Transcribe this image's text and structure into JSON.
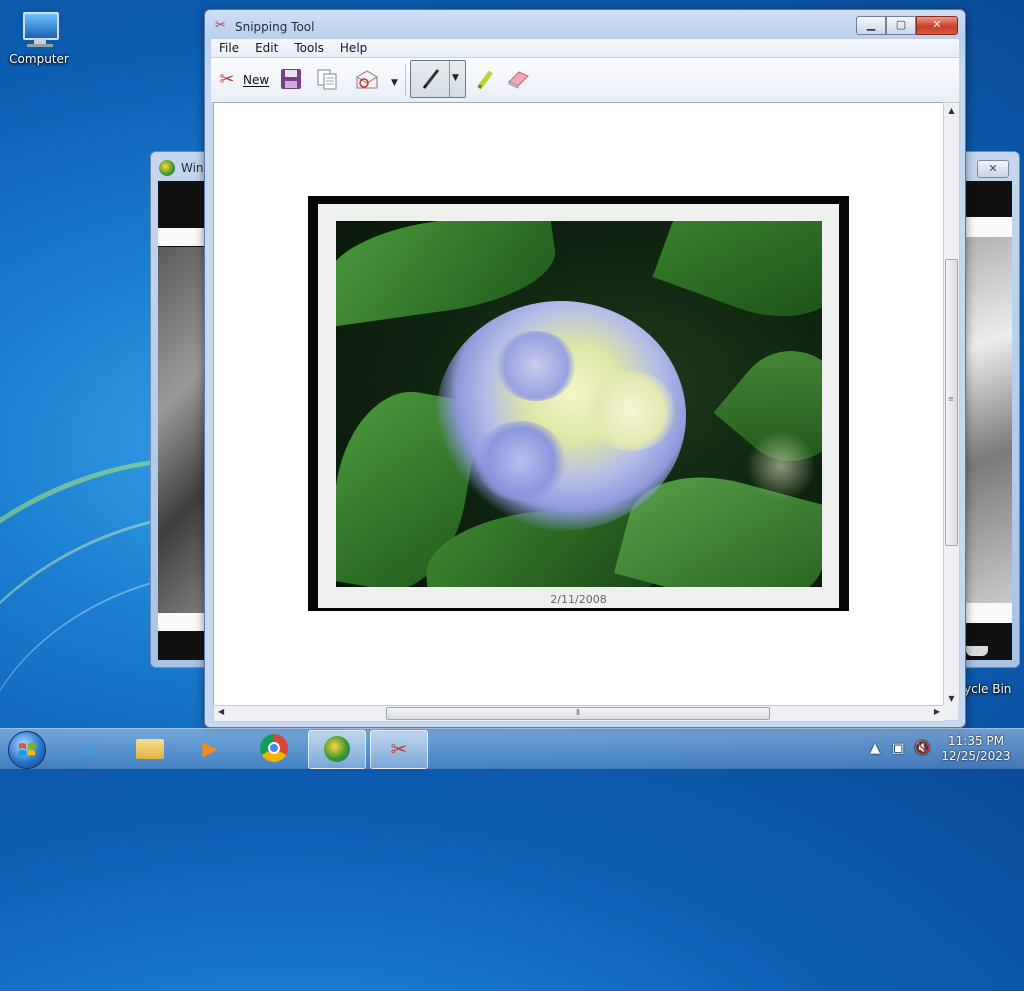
{
  "desktop": {
    "icons": [
      {
        "label": "Computer"
      },
      {
        "label": "ycle Bin"
      }
    ]
  },
  "background_window": {
    "title": "Wind"
  },
  "snipping_tool": {
    "title": "Snipping Tool",
    "menu": [
      "File",
      "Edit",
      "Tools",
      "Help"
    ],
    "toolbar": {
      "new_label": "New"
    },
    "capture": {
      "date_caption": "2/11/2008"
    }
  },
  "taskbar": {
    "clock_time": "11:35 PM",
    "clock_date": "12/25/2023"
  },
  "colors": {
    "desktop_blue": "#0d5fb4",
    "close_red": "#c7412b",
    "window_frame": "#b9cfee"
  }
}
